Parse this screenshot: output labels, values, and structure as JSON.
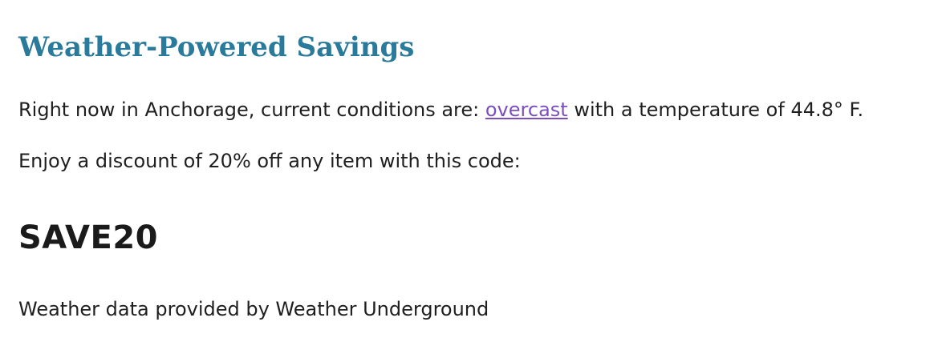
{
  "title": "Weather-Powered Savings",
  "conditions": {
    "prefix": "Right now in Anchorage, current conditions are: ",
    "condition_link": "overcast",
    "suffix": " with a temperature of 44.8° F."
  },
  "discount_text": "Enjoy a discount of 20% off any item with this code:",
  "promo_code": "SAVE20",
  "credit": "Weather data provided by Weather Underground",
  "colors": {
    "title": "#2a7a9b",
    "link": "#7b4fc1",
    "text": "#1f1f1f"
  }
}
